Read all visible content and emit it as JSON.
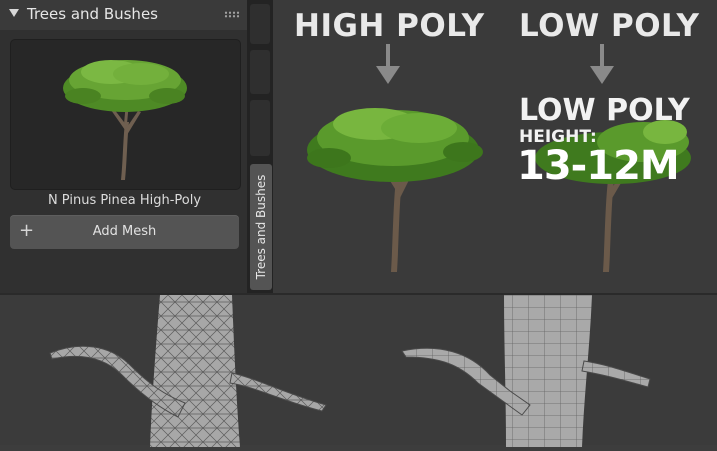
{
  "panel": {
    "title": "Trees and Bushes",
    "asset_name": "N Pinus Pinea High-Poly",
    "add_button_label": "Add Mesh",
    "add_button_icon": "+"
  },
  "sidebar_tab": {
    "label": "Trees and Bushes"
  },
  "viewport": {
    "high_poly_heading": "HIGH POLY",
    "low_poly_heading": "LOW POLY",
    "low_poly_label": "LOW POLY",
    "height_label": "HEIGHT:",
    "height_value": "13-12M"
  },
  "colors": {
    "panel_bg": "#303030",
    "viewport_bg": "#3a3a3a",
    "foliage": "#5e9a2e",
    "trunk": "#6b5a4a"
  }
}
